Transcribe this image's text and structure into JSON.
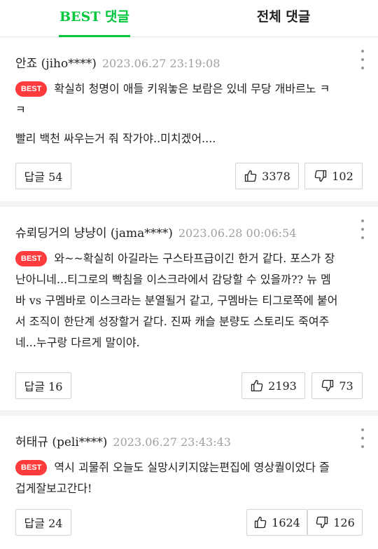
{
  "tabs": [
    {
      "label": "BEST 댓글",
      "active": true
    },
    {
      "label": "전체 댓글",
      "active": false
    }
  ],
  "best_badge": "BEST",
  "comments": [
    {
      "author": "안죠 (jiho****)",
      "date": "2023.06.27 23:19:08",
      "lines": [
        "확실히 청명이 애들 키워놓은 보람은 있네 무당 개바르노 ㅋ",
        "ㅋ",
        "빨리 백천 싸우는거 줘 작가야..미치겠어...."
      ],
      "reply_label": "답글 54",
      "likes": "3378",
      "dislikes": "102"
    },
    {
      "author": "슈뢰딩거의 냥냥이 (jama****)",
      "date": "2023.06.28 00:06:54",
      "lines": [
        "와~~확실히 아길라는 구스타프급이긴 한거 같다. 포스가 장",
        "난아니네...티그로의 빡침을 이스크라에서 감당할 수 있을까?? 뉴 멤",
        "바 vs 구멤바로 이스크라는 분열될거 같고, 구멤바는 티그로쪽에 붙어",
        "서 조직이 한단계 성장할거 같다. 진짜 캐슬 분량도 스토리도 죽여주",
        "네...누구랑 다르게 말이야."
      ],
      "reply_label": "답글 16",
      "likes": "2193",
      "dislikes": "73"
    },
    {
      "author": "허태규 (peli****)",
      "date": "2023.06.27 23:43:43",
      "lines": [
        "역시 괴물쥐 오늘도 실망시키지않는편집에 영상퀄이었다 즐",
        "겁게잘보고간다!"
      ],
      "reply_label": "답글 24",
      "likes": "1624",
      "dislikes": "126"
    }
  ],
  "icons": {
    "like": "thumbs-up-icon",
    "dislike": "thumbs-down-icon",
    "more": "more-vertical-icon"
  },
  "colors": {
    "accent": "#00c73c",
    "best_badge": "#ff3b3b",
    "date": "#a0a0a0",
    "border": "#d4d4d4"
  }
}
